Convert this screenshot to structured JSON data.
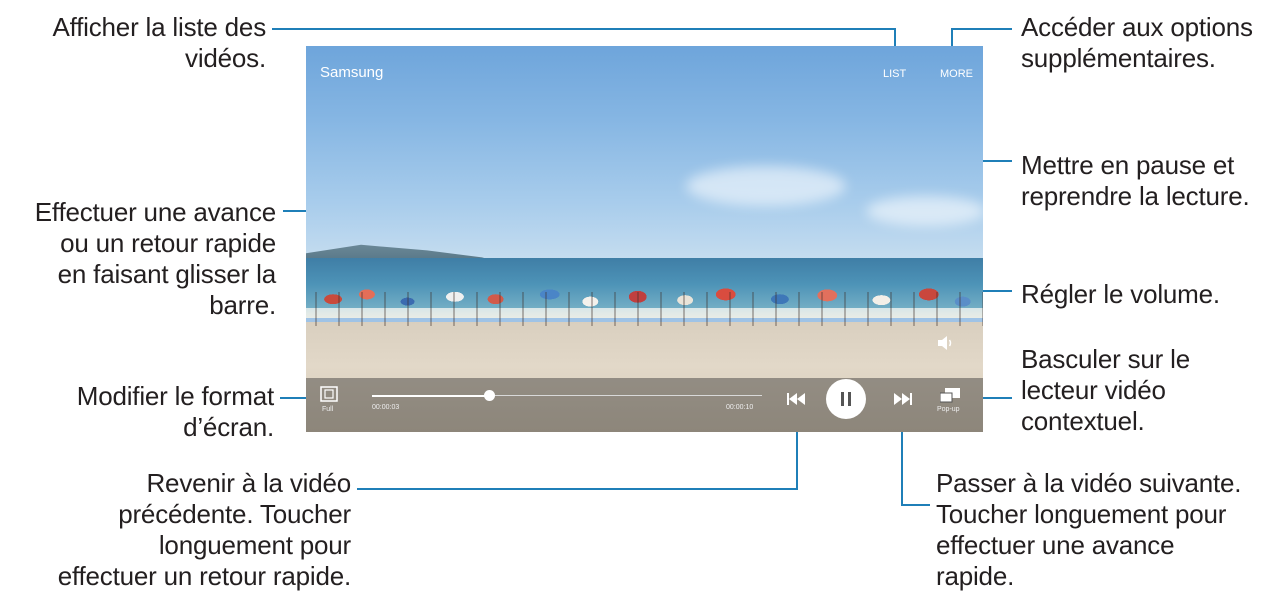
{
  "player": {
    "title": "Samsung",
    "list_label": "LIST",
    "more_label": "MORE",
    "elapsed": "00:00:03",
    "total": "00:00:10",
    "screen_ratio_label": "Full",
    "popup_label": "Pop-up",
    "progress_fraction": 0.3
  },
  "callouts": {
    "list": "Afficher la liste des\nvidéos.",
    "more": "Accéder aux options\nsupplémentaires.",
    "pause": "Mettre en pause et\nreprendre la lecture.",
    "seek": "Effectuer une avance\nou un retour rapide\nen faisant glisser la\nbarre.",
    "volume": "Régler le volume.",
    "popup": "Basculer sur le\nlecteur vidéo\ncontextuel.",
    "ratio": "Modifier le format\nd’écran.",
    "previous": "Revenir à la vidéo\nprécédente. Toucher\nlonguement pour\neffectuer un retour rapide.",
    "next": "Passer à la vidéo suivante.\nToucher longuement pour\neffectuer une avance\nrapide."
  },
  "colors": {
    "leader_line": "#1f7fb8",
    "text": "#231f20"
  }
}
